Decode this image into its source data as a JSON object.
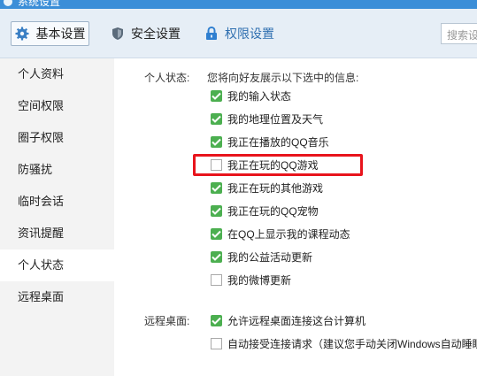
{
  "window": {
    "title": "系统设置"
  },
  "toolbar": {
    "tabs": [
      {
        "label": "基本设置",
        "icon": "gear-icon"
      },
      {
        "label": "安全设置",
        "icon": "shield-icon"
      },
      {
        "label": "权限设置",
        "icon": "lock-icon"
      }
    ],
    "search_placeholder": "搜索设"
  },
  "sidebar": {
    "items": [
      {
        "label": "个人资料"
      },
      {
        "label": "空间权限"
      },
      {
        "label": "圈子权限"
      },
      {
        "label": "防骚扰"
      },
      {
        "label": "临时会话"
      },
      {
        "label": "资讯提醒"
      },
      {
        "label": "个人状态"
      },
      {
        "label": "远程桌面"
      }
    ],
    "active_index": 6
  },
  "status_section": {
    "label": "个人状态:",
    "intro": "您将向好友展示以下选中的信息:",
    "options": [
      {
        "label": "我的输入状态",
        "checked": true
      },
      {
        "label": "我的地理位置及天气",
        "checked": true
      },
      {
        "label": "我正在播放的QQ音乐",
        "checked": true
      },
      {
        "label": "我正在玩的QQ游戏",
        "checked": false
      },
      {
        "label": "我正在玩的其他游戏",
        "checked": true
      },
      {
        "label": "我正在玩的QQ宠物",
        "checked": true
      },
      {
        "label": "在QQ上显示我的课程动态",
        "checked": true
      },
      {
        "label": "我的公益活动更新",
        "checked": true
      },
      {
        "label": "我的微博更新",
        "checked": false
      }
    ]
  },
  "remote_section": {
    "label": "远程桌面:",
    "options": [
      {
        "label": "允许远程桌面连接这台计算机",
        "checked": true
      },
      {
        "label": "自动接受连接请求（建议您手动关闭Windows自动睡眠",
        "checked": false
      }
    ]
  },
  "colors": {
    "titlebar": "#3b8ed8",
    "checkbox_on": "#4caf50",
    "highlight": "#e8141c",
    "sidebar_bg": "#f3f3f3"
  }
}
